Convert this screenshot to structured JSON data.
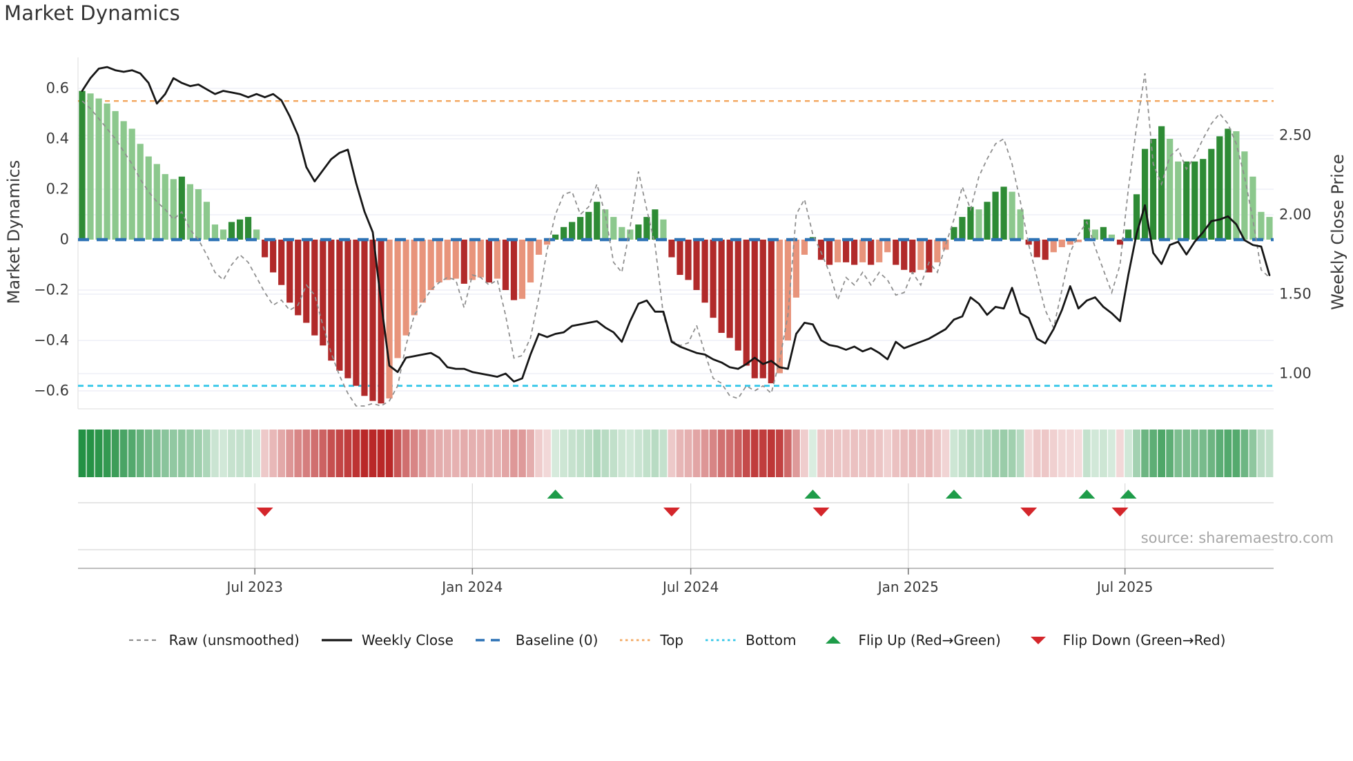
{
  "title": "Market Dynamics",
  "source": "source: sharemaestro.com",
  "axes": {
    "left": {
      "label": "Market Dynamics",
      "ticks": [
        "0.6",
        "0.4",
        "0.2",
        "0",
        "−0.2",
        "−0.4",
        "−0.6"
      ],
      "tick_values": [
        0.6,
        0.4,
        0.2,
        0,
        -0.2,
        -0.4,
        -0.6
      ]
    },
    "right": {
      "label": "Weekly Close Price",
      "ticks": [
        "2.50",
        "2.00",
        "1.50",
        "1.00"
      ],
      "tick_values": [
        2.5,
        2.0,
        1.5,
        1.0
      ]
    },
    "x": {
      "ticks": [
        "Jul 2023",
        "Jan 2024",
        "Jul 2024",
        "Jan 2025",
        "Jul 2025"
      ],
      "tick_weeks": [
        20.8,
        47.0,
        73.3,
        99.5,
        125.6
      ]
    }
  },
  "legend": {
    "items": [
      {
        "label": "Raw (unsmoothed)",
        "swatch": "dashed-line",
        "color": "#8f8f8f"
      },
      {
        "label": "Weekly Close",
        "swatch": "solid-line",
        "color": "#161616"
      },
      {
        "label": "Baseline (0)",
        "swatch": "long-dashes",
        "color": "#2d72b5"
      },
      {
        "label": "Top",
        "swatch": "dotted-line",
        "color": "#f3a963"
      },
      {
        "label": "Bottom",
        "swatch": "dotted-line",
        "color": "#35c7e8"
      },
      {
        "label": "Flip Up (Red→Green)",
        "swatch": "triangle-up",
        "color": "#1e9c49"
      },
      {
        "label": "Flip Down (Green→Red)",
        "swatch": "triangle-down",
        "color": "#d4262b"
      }
    ]
  },
  "colors": {
    "bar_dark_green": "#2e8b35",
    "bar_light_green": "#8cc88d",
    "bar_dark_red": "#b12a2a",
    "bar_light_red": "#e8947b",
    "heat_green_rgb": "26,140,60",
    "heat_red_rgb": "185,40,40",
    "baseline": "#2d72b5",
    "top": "#f3a963",
    "bottom": "#35c7e8",
    "raw": "#8f8f8f",
    "price": "#161616",
    "flip_up": "#1e9c49",
    "flip_down": "#d4262b",
    "grid": "#e9ecf5",
    "panel_line": "#d6d6d6",
    "spine": "#a8a8a8",
    "date_grid": "#d9d9d9"
  },
  "chart_data": {
    "type": "combo",
    "description": "Weekly market-dynamics oscillator bars (left axis) with heatmap strip and flip markers, raw unsmoothed dashed line (left axis) and weekly close price line (right axis).",
    "ylim_left": [
      -0.67,
      0.72
    ],
    "ylim_right": [
      0.78,
      2.99
    ],
    "grid": "horizontal-only",
    "legend_position": "bottom-center",
    "reference_lines": {
      "baseline": 0,
      "top": 0.55,
      "bottom": -0.58
    },
    "flip_up_weeks": [
      57,
      88,
      105,
      121,
      126
    ],
    "flip_down_weeks": [
      22,
      71,
      89,
      114,
      125
    ],
    "series": [
      {
        "name": "Market Dynamics (smoothed bars)",
        "type": "bar",
        "axis": "left",
        "values": [
          0.59,
          0.58,
          0.56,
          0.54,
          0.51,
          0.47,
          0.44,
          0.38,
          0.33,
          0.3,
          0.26,
          0.24,
          0.25,
          0.22,
          0.2,
          0.15,
          0.06,
          0.04,
          0.07,
          0.08,
          0.09,
          0.04,
          -0.07,
          -0.13,
          -0.18,
          -0.25,
          -0.3,
          -0.33,
          -0.38,
          -0.42,
          -0.48,
          -0.52,
          -0.55,
          -0.58,
          -0.62,
          -0.64,
          -0.65,
          -0.63,
          -0.47,
          -0.38,
          -0.3,
          -0.25,
          -0.2,
          -0.17,
          -0.16,
          -0.155,
          -0.175,
          -0.16,
          -0.15,
          -0.17,
          -0.155,
          -0.2,
          -0.24,
          -0.235,
          -0.17,
          -0.06,
          -0.02,
          0.02,
          0.05,
          0.07,
          0.09,
          0.11,
          0.15,
          0.12,
          0.09,
          0.05,
          0.04,
          0.06,
          0.09,
          0.12,
          0.08,
          -0.07,
          -0.14,
          -0.16,
          -0.2,
          -0.25,
          -0.31,
          -0.37,
          -0.39,
          -0.44,
          -0.5,
          -0.55,
          -0.55,
          -0.57,
          -0.53,
          -0.4,
          -0.23,
          -0.06,
          0.01,
          -0.08,
          -0.1,
          -0.09,
          -0.09,
          -0.1,
          -0.09,
          -0.1,
          -0.09,
          -0.05,
          -0.1,
          -0.12,
          -0.13,
          -0.12,
          -0.13,
          -0.09,
          -0.04,
          0.05,
          0.09,
          0.13,
          0.12,
          0.15,
          0.19,
          0.21,
          0.19,
          0.12,
          -0.02,
          -0.07,
          -0.08,
          -0.05,
          -0.03,
          -0.02,
          -0.01,
          0.08,
          0.04,
          0.05,
          0.02,
          -0.02,
          0.04,
          0.18,
          0.36,
          0.4,
          0.45,
          0.4,
          0.31,
          0.31,
          0.31,
          0.32,
          0.36,
          0.41,
          0.44,
          0.43,
          0.35,
          0.25,
          0.11,
          0.09
        ]
      },
      {
        "name": "Raw (unsmoothed)",
        "type": "line",
        "style": "dashed",
        "axis": "left",
        "values": [
          0.55,
          0.52,
          0.48,
          0.44,
          0.4,
          0.35,
          0.3,
          0.24,
          0.19,
          0.15,
          0.12,
          0.08,
          0.11,
          0.04,
          0.0,
          -0.06,
          -0.13,
          -0.16,
          -0.1,
          -0.06,
          -0.09,
          -0.15,
          -0.21,
          -0.26,
          -0.24,
          -0.28,
          -0.26,
          -0.18,
          -0.22,
          -0.34,
          -0.45,
          -0.54,
          -0.61,
          -0.66,
          -0.66,
          -0.65,
          -0.66,
          -0.64,
          -0.58,
          -0.42,
          -0.3,
          -0.25,
          -0.2,
          -0.17,
          -0.15,
          -0.16,
          -0.27,
          -0.14,
          -0.15,
          -0.18,
          -0.16,
          -0.3,
          -0.47,
          -0.46,
          -0.39,
          -0.23,
          -0.04,
          0.1,
          0.18,
          0.19,
          0.1,
          0.13,
          0.22,
          0.1,
          -0.09,
          -0.13,
          0.05,
          0.27,
          0.12,
          -0.02,
          -0.3,
          -0.4,
          -0.42,
          -0.41,
          -0.34,
          -0.45,
          -0.55,
          -0.57,
          -0.62,
          -0.63,
          -0.58,
          -0.6,
          -0.58,
          -0.61,
          -0.48,
          -0.3,
          0.1,
          0.16,
          0.02,
          -0.05,
          -0.13,
          -0.24,
          -0.15,
          -0.18,
          -0.13,
          -0.18,
          -0.13,
          -0.16,
          -0.22,
          -0.21,
          -0.13,
          -0.18,
          -0.09,
          -0.13,
          -0.02,
          0.08,
          0.21,
          0.12,
          0.25,
          0.32,
          0.38,
          0.4,
          0.3,
          0.15,
          -0.02,
          -0.15,
          -0.28,
          -0.35,
          -0.2,
          -0.05,
          0.02,
          0.07,
          -0.03,
          -0.12,
          -0.21,
          -0.1,
          0.2,
          0.45,
          0.66,
          0.3,
          0.22,
          0.33,
          0.36,
          0.28,
          0.33,
          0.4,
          0.46,
          0.5,
          0.46,
          0.38,
          0.25,
          0.08,
          -0.12,
          -0.15
        ]
      },
      {
        "name": "Weekly Close",
        "type": "line",
        "style": "solid",
        "axis": "right",
        "values": [
          2.78,
          2.86,
          2.92,
          2.93,
          2.91,
          2.9,
          2.91,
          2.89,
          2.83,
          2.7,
          2.76,
          2.86,
          2.83,
          2.81,
          2.82,
          2.79,
          2.76,
          2.78,
          2.77,
          2.76,
          2.74,
          2.76,
          2.74,
          2.76,
          2.72,
          2.62,
          2.5,
          2.3,
          2.21,
          2.28,
          2.35,
          2.39,
          2.41,
          2.2,
          2.02,
          1.89,
          1.45,
          1.05,
          1.01,
          1.1,
          1.11,
          1.12,
          1.13,
          1.1,
          1.04,
          1.03,
          1.03,
          1.01,
          1.0,
          0.99,
          0.98,
          1.0,
          0.95,
          0.97,
          1.12,
          1.25,
          1.23,
          1.25,
          1.26,
          1.3,
          1.31,
          1.32,
          1.33,
          1.29,
          1.26,
          1.2,
          1.33,
          1.44,
          1.46,
          1.39,
          1.39,
          1.2,
          1.17,
          1.15,
          1.13,
          1.12,
          1.09,
          1.07,
          1.04,
          1.03,
          1.06,
          1.1,
          1.06,
          1.08,
          1.04,
          1.03,
          1.25,
          1.32,
          1.31,
          1.21,
          1.18,
          1.17,
          1.15,
          1.17,
          1.14,
          1.16,
          1.13,
          1.09,
          1.2,
          1.16,
          1.18,
          1.2,
          1.22,
          1.25,
          1.28,
          1.34,
          1.36,
          1.48,
          1.44,
          1.37,
          1.42,
          1.41,
          1.54,
          1.38,
          1.35,
          1.22,
          1.19,
          1.28,
          1.4,
          1.55,
          1.41,
          1.46,
          1.48,
          1.42,
          1.38,
          1.33,
          1.62,
          1.88,
          2.06,
          1.76,
          1.69,
          1.81,
          1.83,
          1.75,
          1.83,
          1.89,
          1.96,
          1.97,
          1.99,
          1.94,
          1.84,
          1.81,
          1.8,
          1.62
        ]
      }
    ]
  }
}
